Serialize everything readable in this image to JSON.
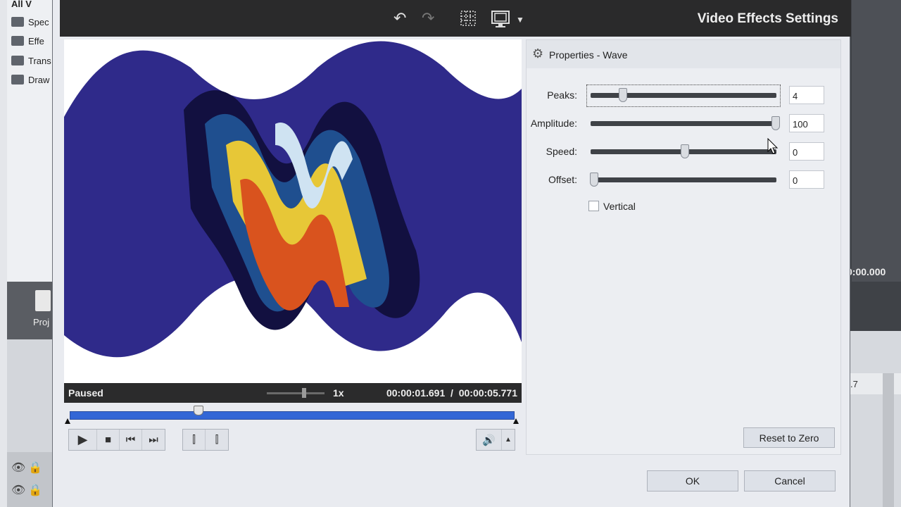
{
  "background_app": {
    "library_items": [
      "All V",
      "Spec",
      "Effe",
      "Trans",
      "Draw"
    ],
    "project_label": "Proj",
    "right_time": "0:00.000",
    "ruler_value": ".7"
  },
  "dialog": {
    "title": "Video Effects Settings",
    "toolbar_icons": [
      "undo-icon",
      "redo-icon",
      "grid-icon",
      "display-icon",
      "dropdown-arrow-icon"
    ]
  },
  "preview": {
    "status": "Paused",
    "speed": "1x",
    "current_time": "00:00:01.691",
    "separator": "/",
    "total_time": "00:00:05.771",
    "progress": 0.29
  },
  "properties": {
    "header": "Properties - Wave",
    "rows": [
      {
        "label": "Peaks:",
        "value": "4",
        "level": 0.16
      },
      {
        "label": "Amplitude:",
        "value": "100",
        "level": 1.0
      },
      {
        "label": "Speed:",
        "value": "0",
        "level": 0.5
      },
      {
        "label": "Offset:",
        "value": "0",
        "level": 0.0
      }
    ],
    "vertical_label": "Vertical",
    "vertical_checked": false,
    "reset_label": "Reset to Zero"
  },
  "footer": {
    "ok_label": "OK",
    "cancel_label": "Cancel"
  }
}
